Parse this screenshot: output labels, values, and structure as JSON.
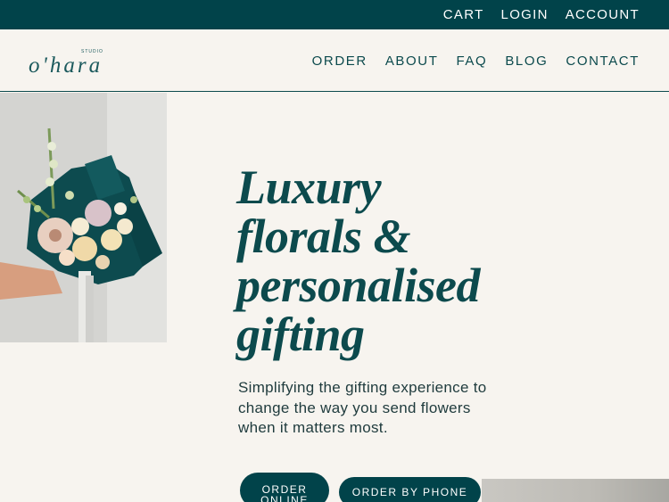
{
  "topbar": {
    "links": [
      "CART",
      "LOGIN",
      "ACCOUNT"
    ]
  },
  "header": {
    "logo_small": "STUDIO",
    "logo_name": "o'hara",
    "nav": [
      "ORDER",
      "ABOUT",
      "FAQ",
      "BLOG",
      "CONTACT"
    ]
  },
  "hero": {
    "title_lines": [
      "Luxury",
      "florals &",
      "personalised",
      "gifting"
    ],
    "subtitle": "Simplifying the gifting experience to change the way you send flowers when it matters most.",
    "buttons": {
      "order_online_lines": [
        "ORDER",
        "ONLINE"
      ],
      "order_phone": "ORDER BY PHONE"
    }
  },
  "colors": {
    "brand_dark_teal": "#01434a",
    "background": "#f7f4ef",
    "text_teal": "#0c4a4d"
  }
}
